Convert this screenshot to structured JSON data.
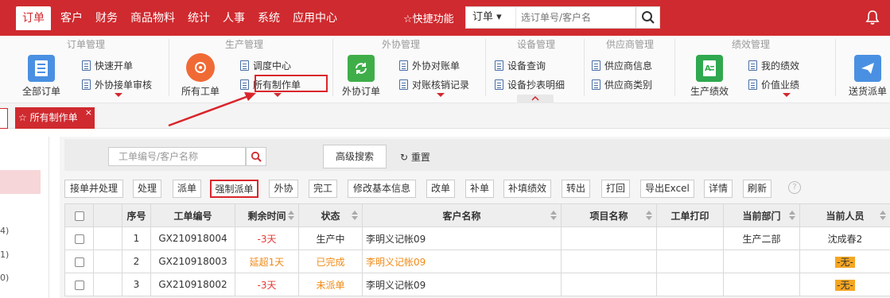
{
  "nav": {
    "items": [
      "订单",
      "客户",
      "财务",
      "商品物料",
      "统计",
      "人事",
      "系统",
      "应用中心"
    ],
    "quick_func": "☆快捷功能",
    "search_select": "订单",
    "search_placeholder": "选订单号/客户名"
  },
  "ribbon": {
    "groups": [
      {
        "title": "订单管理",
        "big": "全部订单",
        "items": [
          "快速开单",
          "外协接单审核"
        ]
      },
      {
        "title": "生产管理",
        "big": "所有工单",
        "items": [
          "调度中心",
          "所有制作单"
        ]
      },
      {
        "title": "外协管理",
        "big": "外协订单",
        "items": [
          "外协对账单",
          "对账核销记录"
        ]
      },
      {
        "title": "设备管理",
        "items": [
          "设备查询",
          "设备抄表明细"
        ]
      },
      {
        "title": "供应商管理",
        "items": [
          "供应商信息",
          "供应商类别"
        ]
      },
      {
        "title": "绩效管理",
        "big": "生产绩效",
        "items": [
          "我的绩效",
          "价值业绩"
        ]
      }
    ],
    "extra_big": "送货派单"
  },
  "tab": {
    "label": "所有制作单",
    "close": "×"
  },
  "left_counts": [
    "4)",
    "1)",
    "0)"
  ],
  "filter": {
    "placeholder": "工单编号/客户名称",
    "advanced": "高级搜索",
    "reset": "重置"
  },
  "toolbar": [
    "接单并处理",
    "处理",
    "派单",
    "强制派单",
    "外协",
    "完工",
    "修改基本信息",
    "改单",
    "补单",
    "补填绩效",
    "转出",
    "打回",
    "导出Excel",
    "详情",
    "刷新"
  ],
  "help_label": "?",
  "table": {
    "headers": [
      "序号",
      "工单编号",
      "剩余时间",
      "状态",
      "客户名称",
      "项目名称",
      "工单打印",
      "当前部门",
      "当前人员"
    ],
    "rows": [
      {
        "no": "1",
        "code": "GX210918004",
        "remain": "-3天",
        "status": "生产中",
        "customer": "李明义记帐09",
        "project": "",
        "print": "",
        "dept": "生产二部",
        "person": "沈成春2"
      },
      {
        "no": "2",
        "code": "GX210918003",
        "remain": "延超1天",
        "status": "已完成",
        "customer": "李明义记帐09",
        "project": "",
        "print": "",
        "dept": "",
        "person": "-无-"
      },
      {
        "no": "3",
        "code": "GX210918002",
        "remain": "-3天",
        "status": "未派单",
        "customer": "李明义记帐09",
        "project": "",
        "print": "",
        "dept": "",
        "person": "-无-"
      }
    ]
  },
  "colors": {
    "brand": "#cf2a2f",
    "warning": "#f08a16",
    "danger": "#e53935"
  }
}
